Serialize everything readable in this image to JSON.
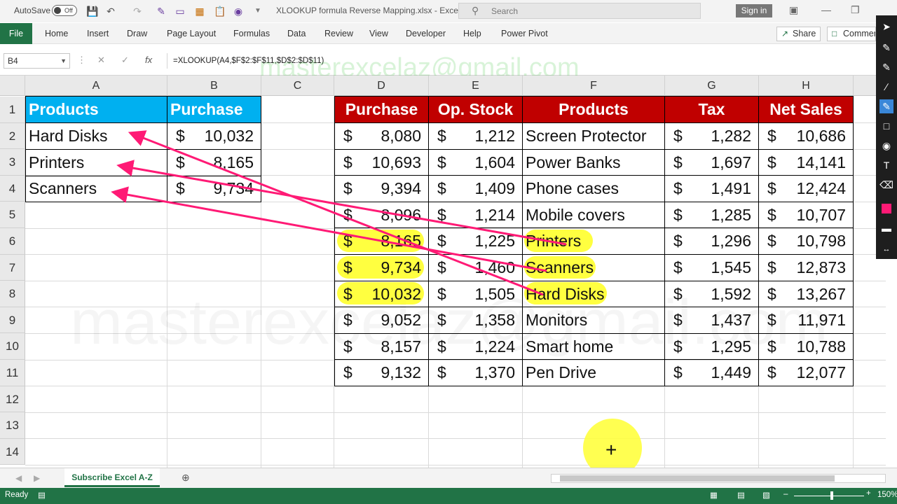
{
  "titlebar": {
    "autosave": "AutoSave",
    "autosave_state": "Off",
    "doc_title": "XLOOKUP formula Reverse Mapping.xlsx  -  Excel",
    "search_placeholder": "Search",
    "signin": "Sign in"
  },
  "ribbon": {
    "file": "File",
    "tabs": [
      "Home",
      "Insert",
      "Draw",
      "Page Layout",
      "Formulas",
      "Data",
      "Review",
      "View",
      "Developer",
      "Help",
      "Power Pivot"
    ],
    "share": "Share",
    "comments": "Commen"
  },
  "formula_bar": {
    "name_box": "B4",
    "formula": "=XLOOKUP(A4,$F$2:$F$11,$D$2:$D$11)"
  },
  "watermark": {
    "top": "masterexcelaz@gmail.com",
    "middle": "masterexcelaz@gmail.com"
  },
  "columns": [
    "A",
    "B",
    "C",
    "D",
    "E",
    "F",
    "G",
    "H"
  ],
  "rows": [
    "1",
    "2",
    "3",
    "4",
    "5",
    "6",
    "7",
    "8",
    "9",
    "10",
    "11",
    "12",
    "13",
    "14"
  ],
  "left_table": {
    "headers": [
      "Products",
      "Purchase"
    ],
    "rows": [
      {
        "product": "Hard Disks",
        "currency": "$",
        "purchase": "10,032"
      },
      {
        "product": "Printers",
        "currency": "$",
        "purchase": "8,165"
      },
      {
        "product": "Scanners",
        "currency": "$",
        "purchase": "9,734"
      }
    ]
  },
  "right_table": {
    "headers": [
      "Purchase",
      "Op. Stock",
      "Products",
      "Tax",
      "Net Sales"
    ],
    "currency": "$",
    "rows": [
      {
        "purchase": "8,080",
        "op_stock": "1,212",
        "product": "Screen Protector",
        "tax": "1,282",
        "net_sales": "10,686"
      },
      {
        "purchase": "10,693",
        "op_stock": "1,604",
        "product": "Power Banks",
        "tax": "1,697",
        "net_sales": "14,141"
      },
      {
        "purchase": "9,394",
        "op_stock": "1,409",
        "product": "Phone cases",
        "tax": "1,491",
        "net_sales": "12,424"
      },
      {
        "purchase": "8,096",
        "op_stock": "1,214",
        "product": "Mobile covers",
        "tax": "1,285",
        "net_sales": "10,707"
      },
      {
        "purchase": "8,165",
        "op_stock": "1,225",
        "product": "Printers",
        "tax": "1,296",
        "net_sales": "10,798"
      },
      {
        "purchase": "9,734",
        "op_stock": "1,460",
        "product": "Scanners",
        "tax": "1,545",
        "net_sales": "12,873"
      },
      {
        "purchase": "10,032",
        "op_stock": "1,505",
        "product": "Hard Disks",
        "tax": "1,592",
        "net_sales": "13,267"
      },
      {
        "purchase": "9,052",
        "op_stock": "1,358",
        "product": "Monitors",
        "tax": "1,437",
        "net_sales": "11,971"
      },
      {
        "purchase": "8,157",
        "op_stock": "1,224",
        "product": "Smart home",
        "tax": "1,295",
        "net_sales": "10,788"
      },
      {
        "purchase": "9,132",
        "op_stock": "1,370",
        "product": "Pen Drive",
        "tax": "1,449",
        "net_sales": "12,077"
      }
    ]
  },
  "sheet_tab": "Subscribe Excel A-Z",
  "status": {
    "ready": "Ready",
    "zoom": "150%"
  },
  "colors": {
    "excel_green": "#217346",
    "header_blue": "#00b0f0",
    "header_red": "#c00000",
    "arrow_pink": "#ff1a75",
    "highlight_yellow": "#ffff00"
  }
}
